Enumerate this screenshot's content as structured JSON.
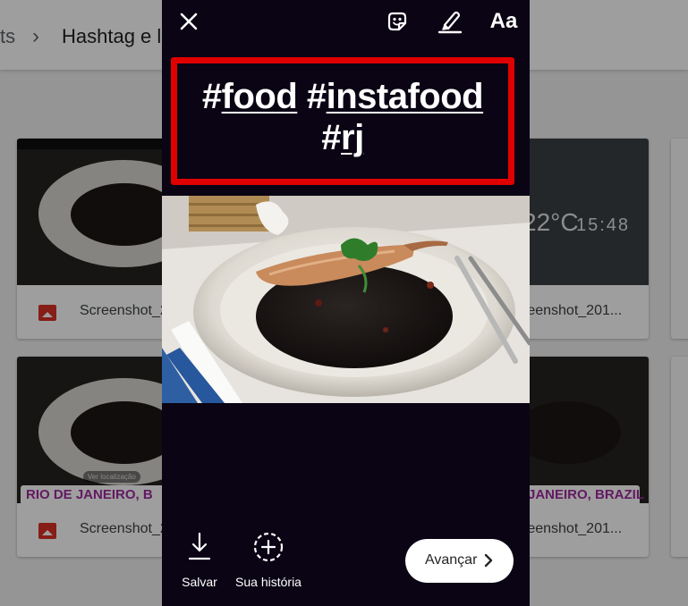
{
  "background": {
    "breadcrumb": {
      "previous": "ts",
      "separator": "›",
      "current": "Hashtag e l"
    },
    "cards": [
      {
        "file_name": "Screenshot_2"
      },
      {
        "file_name": "reenshot_201...",
        "weather_temp": "22°C",
        "weather_time": "15:48"
      },
      {
        "file_name": "Screenshot_2",
        "location_label": "Ver localização",
        "location_sticker": "RIO DE JANEIRO, B"
      },
      {
        "file_name": "reenshot_201...",
        "location_sticker": "JANEIRO, BRAZIL"
      }
    ]
  },
  "story": {
    "toolbar": {
      "close_icon": "close-icon",
      "sticker_icon": "sticker-icon",
      "draw_icon": "draw-icon",
      "text_tool_label": "Aa"
    },
    "hashtags": [
      {
        "hash": "#",
        "word": "food"
      },
      {
        "hash": "#",
        "word": "instafood"
      },
      {
        "hash": "#",
        "word": "rj"
      }
    ],
    "highlight_color": "#e00000",
    "actions": {
      "save_label": "Salvar",
      "story_label": "Sua história",
      "next_label": "Avançar"
    }
  }
}
